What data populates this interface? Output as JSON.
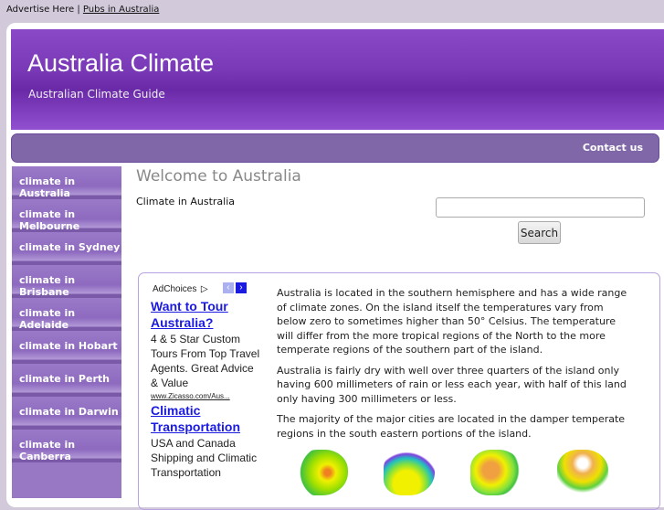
{
  "topbar": {
    "advertise": "Advertise Here",
    "separator": "|",
    "pubs_link": "Pubs in Australia"
  },
  "header": {
    "title": "Australia Climate",
    "subtitle": "Australian Climate Guide"
  },
  "nav": {
    "contact": "Contact us"
  },
  "sidebar": {
    "items": [
      {
        "label": "climate in Australia"
      },
      {
        "label": "climate in Melbourne"
      },
      {
        "label": "climate in Sydney"
      },
      {
        "label": "climate in Brisbane"
      },
      {
        "label": "climate in Adelaide"
      },
      {
        "label": "climate in Hobart"
      },
      {
        "label": "climate in Perth"
      },
      {
        "label": "climate in Darwin"
      },
      {
        "label": "climate in Canberra"
      }
    ]
  },
  "main": {
    "heading": "Welcome to Australia",
    "subheading": "Climate in Australia",
    "search_value": "",
    "search_button": "Search"
  },
  "ads": {
    "adchoices": "AdChoices",
    "prev": "‹",
    "next": "›",
    "items": [
      {
        "title": "Want to Tour Australia?",
        "desc": "4 & 5 Star Custom Tours From Top Travel Agents. Great Advice & Value",
        "url": "www.Zicasso.com/Aus..."
      },
      {
        "title": "Climatic Transportation",
        "desc": "USA and Canada Shipping and Climatic Transportation"
      }
    ]
  },
  "content": {
    "paragraphs": [
      "Australia is located in the southern hemisphere and has a wide range of climate zones. On the island itself the temperatures vary from below zero to sometimes higher than 50° Celsius. The temperature will differ from the more tropical regions of the North to the more temperate regions of the southern part of the island.",
      "Australia is fairly dry with well over three quarters of the island only having 600 millimeters of rain or less each year, with half of this land only having 300 millimeters or less.",
      "The majority of the major cities are located in the damper temperate regions in the south eastern portions of the island."
    ]
  },
  "colors": {
    "header": "#7a3ab8",
    "nav": "#8068a8",
    "sidebar": "#9878c4",
    "ad_link": "#1a1ae0"
  }
}
